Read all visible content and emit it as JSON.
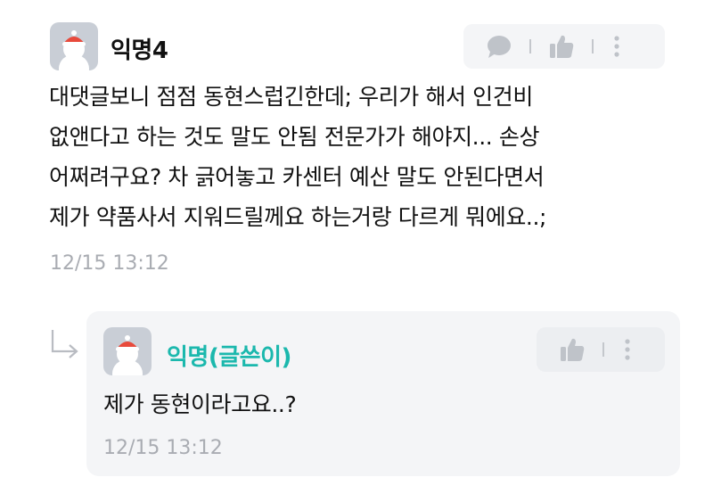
{
  "comment": {
    "author": "익명4",
    "text": "대댓글보니 점점 동현스럽긴한데; 우리가 해서 인건비\n없앤다고 하는 것도 말도 안됨 전문가가 해야지... 손상\n어쩌려구요? 차 긁어놓고 카센터 예산 말도 안된다면서\n제가 약품사서 지워드릴께요 하는거랑 다르게 뭐에요..;",
    "time": "12/15 13:12",
    "icons": [
      "speech-bubble-icon",
      "thumbs-up-icon",
      "more-vertical-icon"
    ]
  },
  "reply": {
    "author": "익명(글쓴이)",
    "author_color": "#1bb8ad",
    "text": "제가 동현이라고요..?",
    "time": "12/15 13:12",
    "icons": [
      "reply-arrow-icon",
      "thumbs-up-icon",
      "more-vertical-icon"
    ]
  },
  "colors": {
    "avatar_bg": "#c9ced6",
    "avatar_hat": "#e84a3c",
    "toolbar_bg": "#f4f5f7",
    "timestamp": "#a9acb2"
  }
}
